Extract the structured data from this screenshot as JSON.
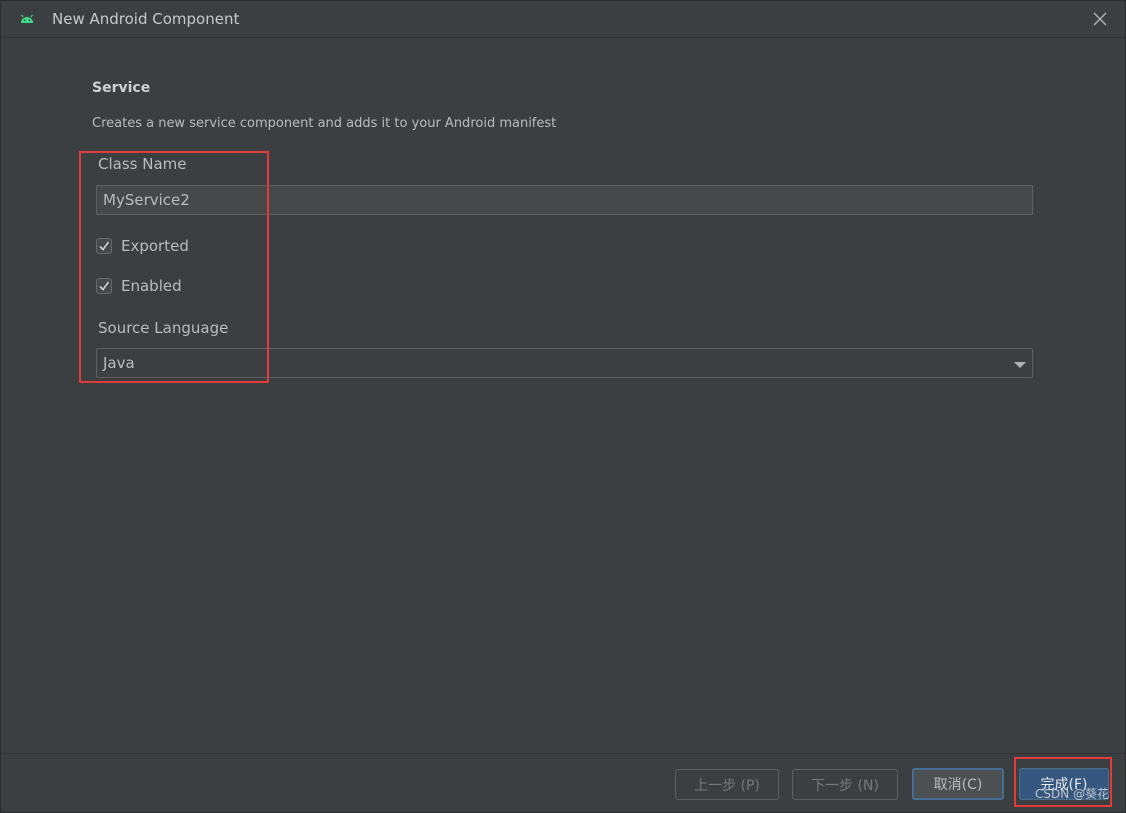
{
  "window": {
    "title": "New Android Component",
    "icon": "android-icon",
    "close_icon": "close-icon"
  },
  "section": {
    "title": "Service",
    "description": "Creates a new service component and adds it to your Android manifest"
  },
  "form": {
    "class_name_label": "Class Name",
    "class_name_value": "MyService2",
    "exported_label": "Exported",
    "exported_checked": true,
    "enabled_label": "Enabled",
    "enabled_checked": true,
    "source_language_label": "Source Language",
    "source_language_value": "Java"
  },
  "footer": {
    "prev_label": "上一步 (P)",
    "next_label": "下一步 (N)",
    "cancel_label": "取消(C)",
    "finish_label": "完成(F)"
  },
  "watermark": "CSDN @葵花",
  "colors": {
    "accent": "#365880",
    "highlight": "#e03c3c",
    "android_green": "#3ddc84"
  }
}
